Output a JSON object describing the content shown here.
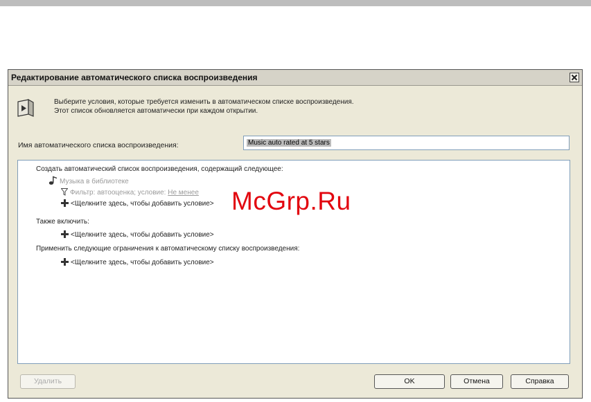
{
  "dialog": {
    "title": "Редактирование автоматического списка воспроизведения",
    "description_line1": "Выберите условия, которые требуется изменить в автоматическом списке воспроизведения.",
    "description_line2": "Этот список обновляется автоматически при каждом открытии.",
    "name_label": "Имя автоматического списка воспроизведения:",
    "name_value": "Music auto rated at 5 stars"
  },
  "tree": {
    "header": "Создать автоматический список воспроизведения, содержащий следующее:",
    "library": "Музыка в библиотеке",
    "filter_prefix": "Фильтр: автооценка; условие:",
    "filter_link": "Не менее",
    "add_condition_1": "<Щелкните здесь, чтобы добавить условие>",
    "also_include": "Также включить:",
    "add_condition_2": "<Щелкните здесь, чтобы добавить условие>",
    "restrictions": "Применить следующие ограничения к автоматическому списку воспроизведения:",
    "add_condition_3": "<Щелкните здесь, чтобы добавить условие>"
  },
  "buttons": {
    "delete": "Удалить",
    "ok": "OK",
    "cancel": "Отмена",
    "help": "Справка"
  },
  "watermark": "McGrp.Ru",
  "icons": {
    "header": "playlist-icon",
    "library": "music-note-icon",
    "filter": "funnel-icon",
    "add": "plus-icon",
    "close": "close-icon"
  }
}
